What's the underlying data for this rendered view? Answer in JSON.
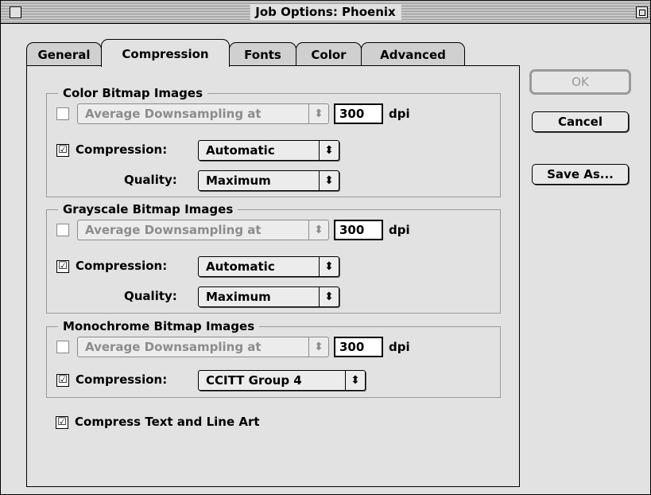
{
  "window": {
    "title": "Job Options: Phoenix"
  },
  "tabs": [
    {
      "label": "General"
    },
    {
      "label": "Compression"
    },
    {
      "label": "Fonts"
    },
    {
      "label": "Color"
    },
    {
      "label": "Advanced"
    }
  ],
  "active_tab": "Compression",
  "groups": [
    {
      "title": "Color Bitmap Images",
      "downsampling": {
        "checked": false,
        "method": "Average Downsampling at",
        "dpi": "300",
        "unit": "dpi"
      },
      "compression": {
        "checked": true,
        "label": "Compression:",
        "value": "Automatic"
      },
      "quality": {
        "label": "Quality:",
        "value": "Maximum"
      }
    },
    {
      "title": "Grayscale Bitmap Images",
      "downsampling": {
        "checked": false,
        "method": "Average Downsampling at",
        "dpi": "300",
        "unit": "dpi"
      },
      "compression": {
        "checked": true,
        "label": "Compression:",
        "value": "Automatic"
      },
      "quality": {
        "label": "Quality:",
        "value": "Maximum"
      }
    },
    {
      "title": "Monochrome Bitmap Images",
      "downsampling": {
        "checked": false,
        "method": "Average Downsampling at",
        "dpi": "300",
        "unit": "dpi"
      },
      "compression": {
        "checked": true,
        "label": "Compression:",
        "value": "CCITT Group 4"
      }
    }
  ],
  "compress_text": {
    "checked": true,
    "label": "Compress Text and Line Art"
  },
  "buttons": {
    "ok": "OK",
    "cancel": "Cancel",
    "save_as": "Save As..."
  },
  "glyphs": {
    "check": "☑",
    "unchecked": "",
    "arrows": "⬍"
  }
}
